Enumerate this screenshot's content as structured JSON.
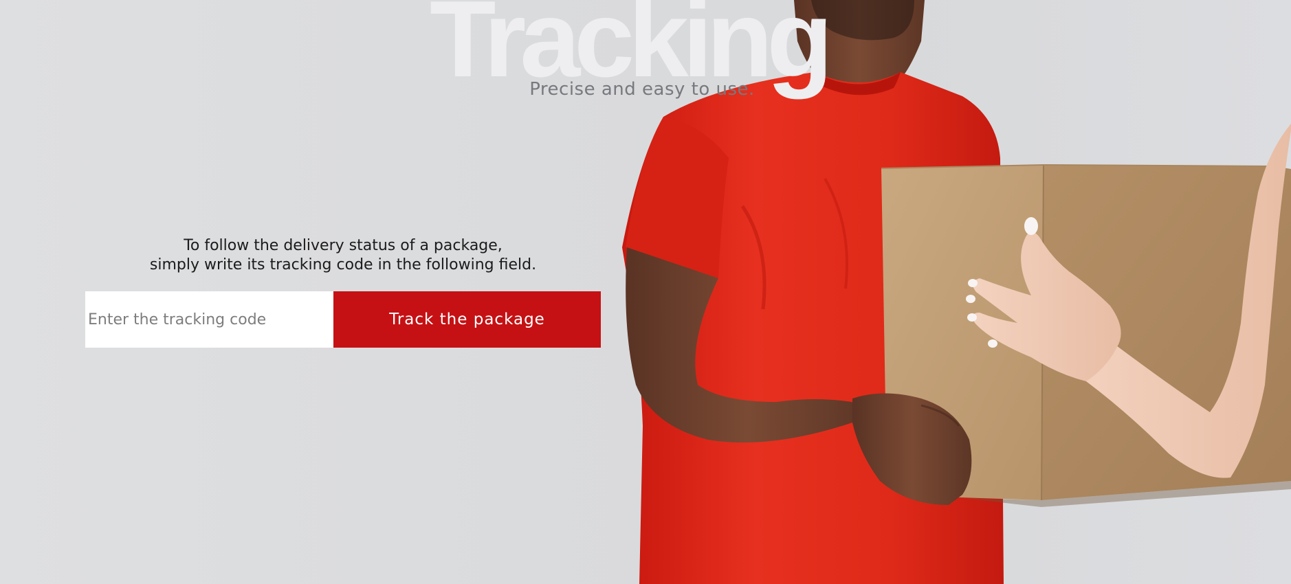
{
  "hero": {
    "title": "Tracking",
    "subtitle": "Precise and easy to use."
  },
  "form": {
    "instruction_line_1": "To follow the delivery status of a package,",
    "instruction_line_2": "simply write its tracking code in the following field.",
    "input_placeholder": "Enter the tracking code",
    "input_value": "",
    "button_label": "Track the package"
  },
  "colors": {
    "accent": "#c51114",
    "background": "#dcdddf",
    "shirt": "#e32a1c",
    "box": "#c6a47c"
  }
}
